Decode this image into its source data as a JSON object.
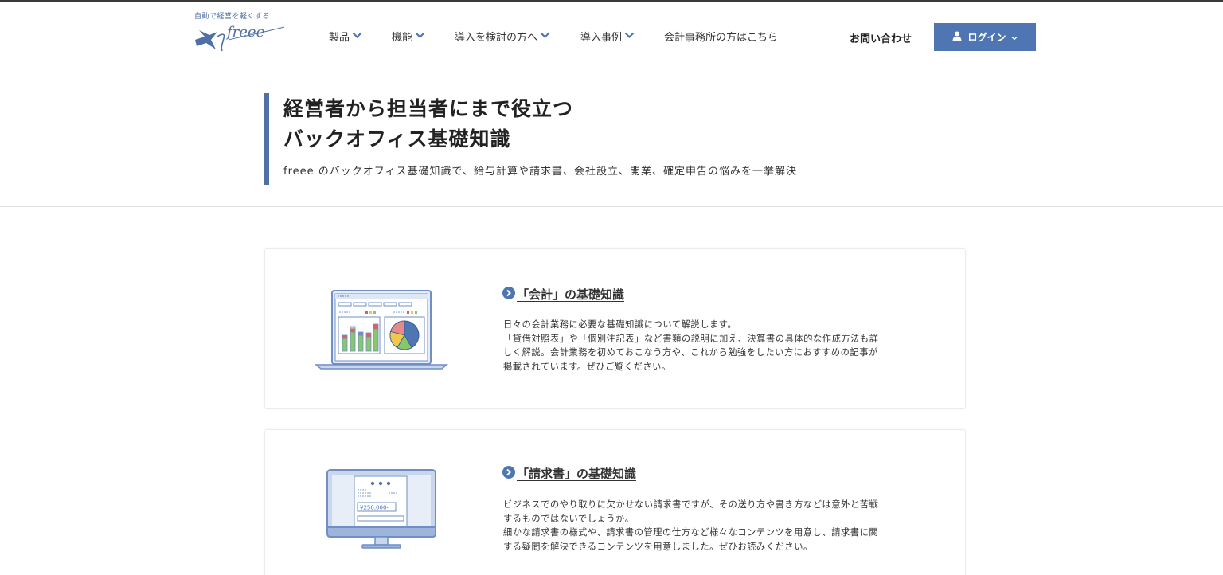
{
  "header": {
    "logo_tagline": "自動で経営を軽くする",
    "logo_text": "freee",
    "nav": [
      {
        "label": "製品",
        "has_dropdown": true
      },
      {
        "label": "機能",
        "has_dropdown": true
      },
      {
        "label": "導入を検討の方へ",
        "has_dropdown": true
      },
      {
        "label": "導入事例",
        "has_dropdown": true
      },
      {
        "label": "会計事務所の方はこちら",
        "has_dropdown": false
      }
    ],
    "contact_label": "お問い合わせ",
    "login_label": "ログイン"
  },
  "hero": {
    "title_line1": "経営者から担当者にまで役立つ",
    "title_line2": "バックオフィス基礎知識",
    "subtitle": "freee のバックオフィス基礎知識で、給与計算や請求書、会社設立、開業、確定申告の悩みを一挙解決"
  },
  "cards": [
    {
      "title": "「会計」の基礎知識",
      "description_lines": [
        "日々の会計業務に必要な基礎知識について解説します。",
        "「貸借対照表」や「個別注記表」など書類の説明に加え、決算書の具体的な作成方法も詳",
        "しく解説。会計業務を初めておこなう方や、これから勉強をしたい方におすすめの記事が",
        "掲載されています。ぜひご覧ください。"
      ]
    },
    {
      "title": "「請求書」の基礎知識",
      "invoice_amount": "¥250,000-",
      "description_lines": [
        "ビジネスでのやり取りに欠かせない請求書ですが、その送り方や書き方などは意外と苦戦",
        "するものではないでしょうか。",
        "細かな請求書の様式や、請求書の管理の仕方など様々なコンテンツを用意し、請求書に関",
        "する疑問を解決できるコンテンツを用意しました。ぜひお読みください。"
      ]
    }
  ],
  "colors": {
    "brand_blue": "#4f76b3",
    "accent_bar": "#4f6fa5",
    "illustration_blue": "#6f8fc6"
  }
}
